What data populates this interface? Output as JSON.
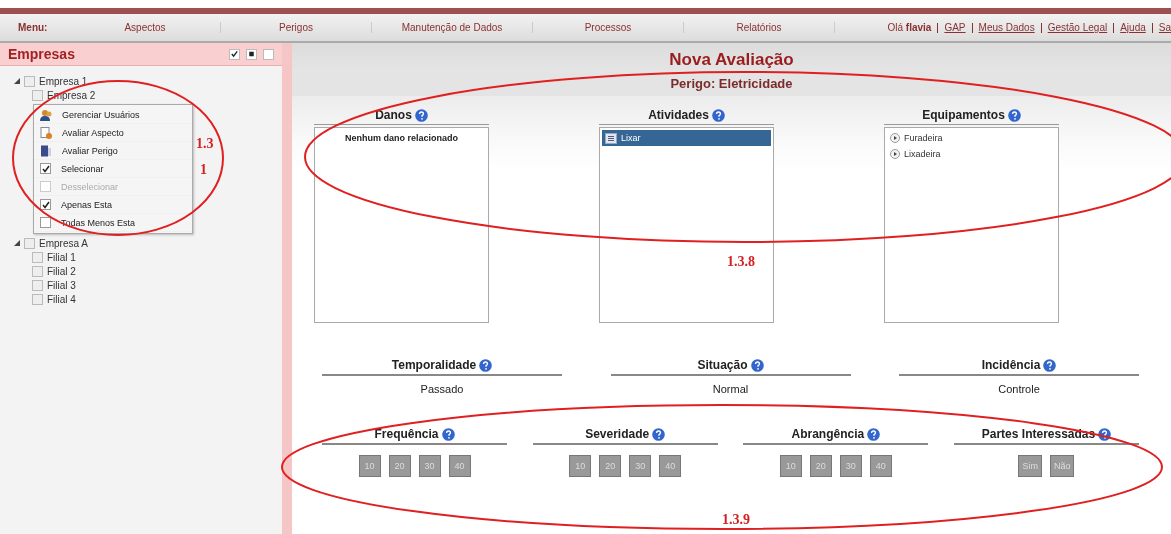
{
  "nav": {
    "label": "Menu:",
    "items": [
      "Aspectos",
      "Perigos",
      "Manutenção de Dados",
      "Processos",
      "Relatórios"
    ],
    "greeting": "Olá **flavia**",
    "links": [
      "GAP",
      "Meus Dados",
      "Gestão Legal",
      "Ajuda",
      "Sa"
    ]
  },
  "sidebar": {
    "title": "Empresas",
    "tree": [
      {
        "label": "Empresa 1",
        "checked": false,
        "children": [
          {
            "label": "Empresa 2",
            "checked": false
          }
        ]
      },
      {
        "label": "Empresa A",
        "checked": false,
        "children": [
          {
            "label": "Filial 1",
            "checked": false
          },
          {
            "label": "Filial 2",
            "checked": false
          },
          {
            "label": "Filial 3",
            "checked": false
          },
          {
            "label": "Filial 4",
            "checked": false
          }
        ]
      }
    ],
    "context_menu": [
      {
        "kind": "icon",
        "label": "Gerenciar Usuários"
      },
      {
        "kind": "icon",
        "label": "Avaliar Aspecto"
      },
      {
        "kind": "icon",
        "label": "Avaliar Perigo"
      },
      {
        "kind": "check",
        "label": "Selecionar",
        "checked": true,
        "disabled": false
      },
      {
        "kind": "check",
        "label": "Desselecionar",
        "checked": false,
        "disabled": true
      },
      {
        "kind": "check",
        "label": "Apenas Esta",
        "checked": true,
        "disabled": false
      },
      {
        "kind": "check",
        "label": "Todas Menos Esta",
        "checked": false,
        "disabled": false
      }
    ]
  },
  "page": {
    "title": "Nova Avaliação",
    "subtitle": "Perigo: Eletricidade"
  },
  "lists": [
    {
      "title": "Danos",
      "empty_text": "Nenhum dano relacionado"
    },
    {
      "title": "Atividades",
      "kind": "activity",
      "items": [
        {
          "label": "Lixar",
          "selected": true
        }
      ]
    },
    {
      "title": "Equipamentos",
      "kind": "equipment",
      "items": [
        {
          "label": "Furadeira",
          "selected": false
        },
        {
          "label": "Lixadeira",
          "selected": false
        }
      ]
    }
  ],
  "fields": [
    {
      "title": "Temporalidade",
      "value": "Passado"
    },
    {
      "title": "Situação",
      "value": "Normal"
    },
    {
      "title": "Incidência",
      "value": "Controle"
    }
  ],
  "scores": [
    {
      "title": "Frequência",
      "options": [
        "10",
        "20",
        "30",
        "40"
      ]
    },
    {
      "title": "Severidade",
      "options": [
        "10",
        "20",
        "30",
        "40"
      ]
    },
    {
      "title": "Abrangência",
      "options": [
        "10",
        "20",
        "30",
        "40"
      ]
    },
    {
      "title": "Partes Interessadas",
      "options": [
        "Sim",
        "Não"
      ]
    }
  ],
  "annotations": [
    "1.3",
    "1",
    "1.3.8",
    "1.3.9"
  ]
}
